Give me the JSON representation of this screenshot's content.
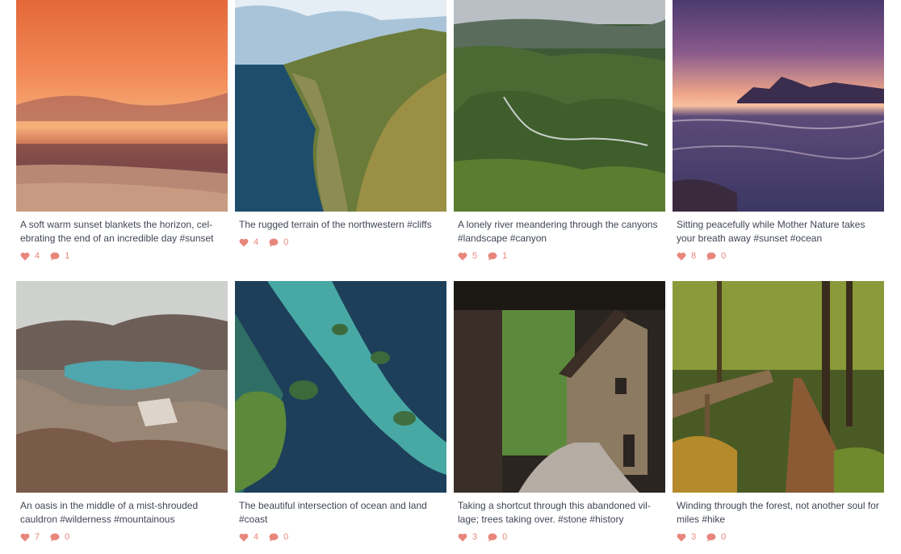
{
  "colors": {
    "accent": "#e8867c",
    "text": "#3f4654"
  },
  "icons": {
    "like": "heart-icon",
    "comment": "comment-bubble-icon"
  },
  "posts": [
    {
      "caption": "A soft warm sunset blankets the horizon, cel-ebrating the end of an incredible day #sunset",
      "likes": "4",
      "comments": "1"
    },
    {
      "caption": "The rugged terrain of the northwestern #cliffs",
      "likes": "4",
      "comments": "0"
    },
    {
      "caption": "A lonely river meandering through the canyons #landscape #canyon",
      "likes": "5",
      "comments": "1"
    },
    {
      "caption": "Sitting peacefully while Mother Nature takes your breath away #sunset #ocean",
      "likes": "8",
      "comments": "0"
    },
    {
      "caption": "An oasis in the middle of a mist-shrouded cauldron #wilderness #mountainous",
      "likes": "7",
      "comments": "0"
    },
    {
      "caption": "The beautiful intersection of ocean and land #coast",
      "likes": "4",
      "comments": "0"
    },
    {
      "caption": "Taking a shortcut through this abandoned vil-lage; trees taking over. #stone #history",
      "likes": "3",
      "comments": "0"
    },
    {
      "caption": "Winding through the forest, not another soul for miles #hike",
      "likes": "3",
      "comments": "0"
    }
  ]
}
